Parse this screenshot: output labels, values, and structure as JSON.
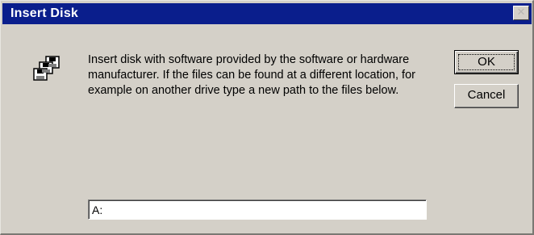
{
  "window": {
    "title": "Insert Disk",
    "close_glyph": "✕"
  },
  "dialog": {
    "icon": "floppy-disks-icon",
    "message": "Insert disk with software provided by the software or hardware manufacturer. If the files can be found at a different location, for example on another drive type a new path to the files below."
  },
  "buttons": {
    "ok_label": "OK",
    "cancel_label": "Cancel"
  },
  "path_field": {
    "value": "A:"
  },
  "colors": {
    "titlebar": "#0a1e8c",
    "face": "#d4d0c8"
  }
}
